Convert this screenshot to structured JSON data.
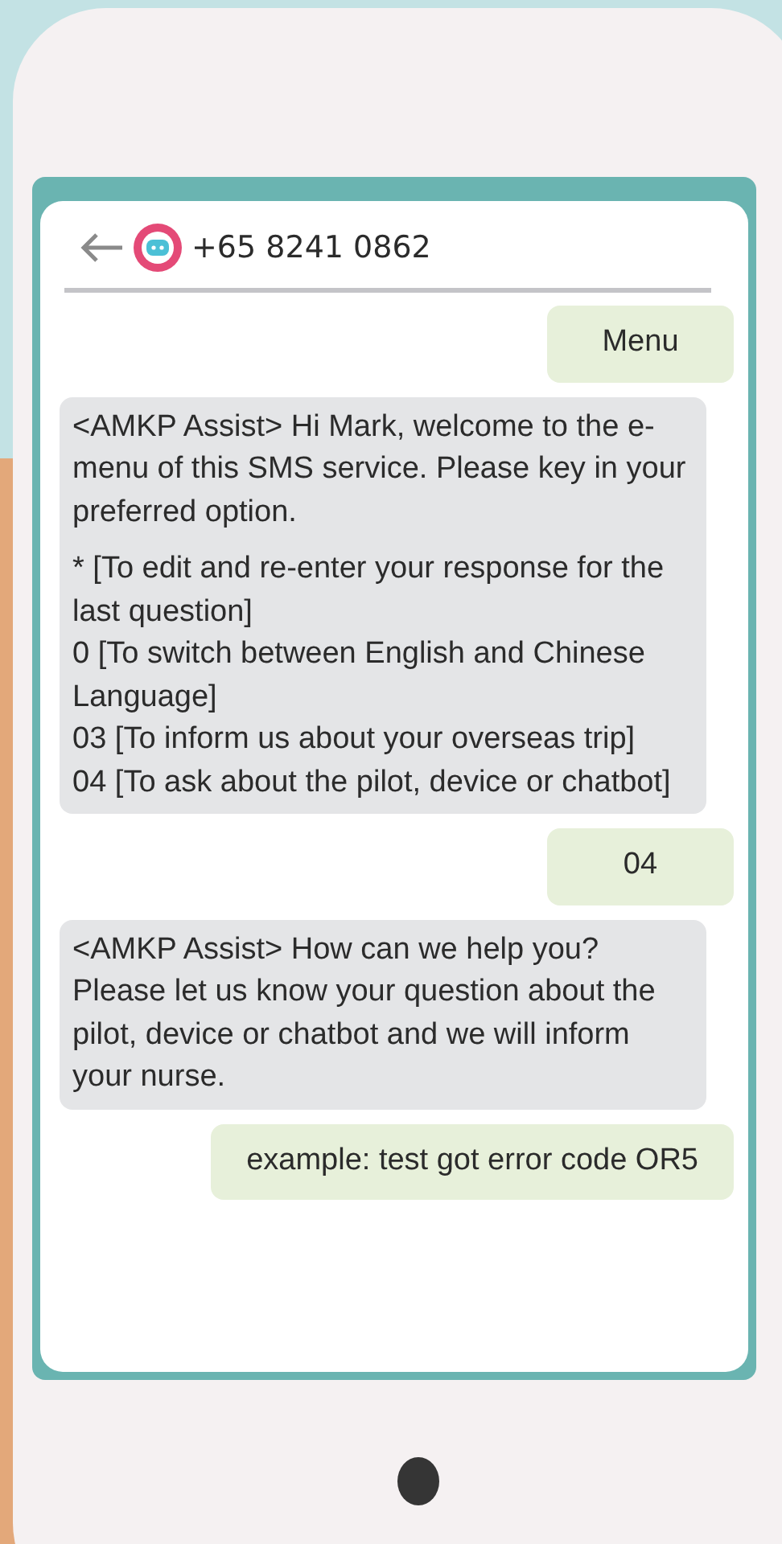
{
  "header": {
    "phone_number": "+65 8241 0862"
  },
  "messages": [
    {
      "kind": "sent",
      "blocks": [
        {
          "kind": "para",
          "text": "Menu"
        }
      ]
    },
    {
      "kind": "received",
      "blocks": [
        {
          "kind": "para",
          "text": "<AMKP Assist> Hi Mark, welcome to the e-menu of this SMS service. Please key in your preferred option."
        },
        {
          "kind": "option",
          "text": "* [To edit and re-enter your response for the last question]"
        },
        {
          "kind": "option",
          "text": "0 [To switch between English and Chinese    Language]"
        },
        {
          "kind": "option",
          "text": "03 [To inform us about your overseas trip]"
        },
        {
          "kind": "option",
          "text": "04 [To ask about the pilot, device or chatbot]"
        }
      ]
    },
    {
      "kind": "sent",
      "blocks": [
        {
          "kind": "para",
          "text": "04"
        }
      ]
    },
    {
      "kind": "received",
      "blocks": [
        {
          "kind": "para",
          "text": "<AMKP Assist> How can we help you? Please let us know your question about the pilot, device or chatbot and we will inform your nurse."
        }
      ]
    },
    {
      "kind": "sent",
      "blocks": [
        {
          "kind": "para",
          "text": "example: test got error code OR5"
        }
      ]
    }
  ]
}
